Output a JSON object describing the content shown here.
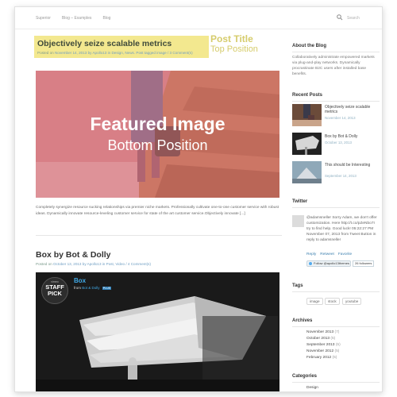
{
  "breadcrumb": [
    "Superior",
    "Blog – Examples",
    "Blog"
  ],
  "search": {
    "placeholder": "Search"
  },
  "post1": {
    "title": "Objectively seize scalable metrics",
    "meta_prefix": "Posted on",
    "meta_rest": "November 14, 2013 by Apollo13 in Design, News. Post tagged image / 3 Comment(s)",
    "annotation_title": "Post Title",
    "annotation_sub": "Top Position",
    "featured_line1": "Featured Image",
    "featured_line2": "Bottom Position",
    "excerpt": "Completely synergize resource sucking relationships via premier niche markets. Professionally cultivate one-to-one customer service with robust ideas. Dynamically innovate resource-leveling customer service for state of the art customer service.Objectively innovate [...]"
  },
  "post2": {
    "title": "Box by Bot & Dolly",
    "meta_prefix": "Posted on",
    "meta_rest": "October 13, 2013 by Apollo13 in Post, Video / 4 Comment(s)",
    "video": {
      "staff_top": "vimeo",
      "staff_line1": "STAFF",
      "staff_line2": "PICK",
      "title": "Box",
      "from_label": "from",
      "channel": "Bot & Dolly",
      "badge": "PLUS"
    }
  },
  "sidebar": {
    "about_heading": "About the Blog",
    "about_text": "Collaboratively administrate empowered markets via plug-and-play networks. Dynamically procrastinate B2C users after installed base benefits.",
    "recent_heading": "Recent Posts",
    "recent_posts": [
      {
        "title": "Objectively seize scalable metrics",
        "date": "November 14, 2013"
      },
      {
        "title": "Box by Bot & Dolly",
        "date": "October 13, 2013"
      },
      {
        "title": "This should be Interesting",
        "date": "September 14, 2013"
      }
    ],
    "twitter_heading": "Twitter",
    "tweet_text": "@adamsneller Sorry Adam, we don't offer customization. Here http://t.co/pZeNbo7I try to find help. Good luck! 05:22:27 PM November 07, 2013 from Tweet Button in reply to adamsneller",
    "tweet_actions": [
      "Reply",
      "Retweet",
      "Favorite"
    ],
    "follow_label": "Follow @apollo13themes",
    "followers_label": "26 followers",
    "tags_heading": "Tags",
    "tags": [
      "image",
      "stock",
      "youtube"
    ],
    "archives_heading": "Archives",
    "archives": [
      {
        "month": "November 2013",
        "count": "(7)"
      },
      {
        "month": "October 2013",
        "count": "(5)"
      },
      {
        "month": "September 2013",
        "count": "(5)"
      },
      {
        "month": "November 2012",
        "count": "(5)"
      },
      {
        "month": "February 2012",
        "count": "(5)"
      }
    ],
    "categories_heading": "Categories",
    "categories": [
      "Design"
    ]
  },
  "colors": {
    "accent_yellow": "#f3e88f",
    "annotation_text": "#d6cc6c",
    "link_blue": "#6f9ec2",
    "featured_overlay": "#d87a80",
    "vimeo_blue": "#40a9e6"
  },
  "icons": {
    "search": "search-icon",
    "twitter": "twitter-bird-icon"
  }
}
